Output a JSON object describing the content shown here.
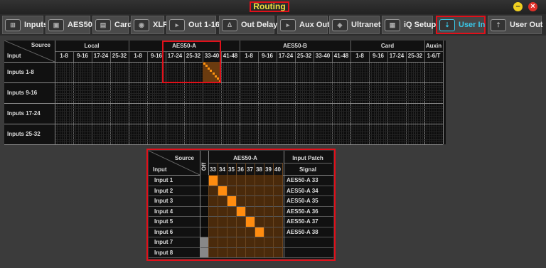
{
  "window": {
    "title": "Routing",
    "minimize_icon": "minimize-icon",
    "close_icon": "close-icon"
  },
  "tabs": [
    {
      "label": "Inputs",
      "icon": "inputs-icon"
    },
    {
      "label": "AES50",
      "icon": "aes50-icon"
    },
    {
      "label": "Card",
      "icon": "card-icon"
    },
    {
      "label": "XLR",
      "icon": "xlr-icon"
    },
    {
      "label": "Out 1-16",
      "icon": "out-icon"
    },
    {
      "label": "Out Delay",
      "icon": "delay-icon"
    },
    {
      "label": "Aux Out",
      "icon": "aux-out-icon"
    },
    {
      "label": "Ultranet",
      "icon": "ultranet-icon"
    },
    {
      "label": "iQ Setup",
      "icon": "iq-setup-icon"
    },
    {
      "label": "User In",
      "icon": "user-in-icon",
      "active": true
    },
    {
      "label": "User Out",
      "icon": "user-out-icon"
    }
  ],
  "matrix": {
    "source_label": "Source",
    "input_label": "Input",
    "groups": [
      "Local",
      "AES50-A",
      "AES50-B",
      "Card",
      "Auxin"
    ],
    "cols": [
      "1-8",
      "9-16",
      "17-24",
      "25-32",
      "1-8",
      "9-16",
      "17-24",
      "25-32",
      "33-40",
      "41-48",
      "1-8",
      "9-16",
      "17-24",
      "25-32",
      "33-40",
      "41-48",
      "1-8",
      "9-16",
      "17-24",
      "25-32",
      "1-6/T"
    ],
    "rows": [
      "Inputs 1-8",
      "Inputs 9-16",
      "Inputs 17-24",
      "Inputs 25-32"
    ],
    "routed": "Inputs 1-8 → AES50-A 33-40"
  },
  "user_in": {
    "source_label": "Source",
    "input_label": "Input",
    "off_label": "Off",
    "group": "AES50-A",
    "channels": [
      "33",
      "34",
      "35",
      "36",
      "37",
      "38",
      "39",
      "40"
    ],
    "patch_header": "Input Patch",
    "signal_header": "Signal",
    "rows": [
      {
        "label": "Input 1",
        "signal": "AES50-A 33"
      },
      {
        "label": "Input 2",
        "signal": "AES50-A 34"
      },
      {
        "label": "Input 3",
        "signal": "AES50-A 35"
      },
      {
        "label": "Input 4",
        "signal": "AES50-A 36"
      },
      {
        "label": "Input 5",
        "signal": "AES50-A 37"
      },
      {
        "label": "Input 6",
        "signal": "AES50-A 38"
      },
      {
        "label": "Input 7",
        "signal": ""
      },
      {
        "label": "Input 8",
        "signal": ""
      }
    ]
  }
}
